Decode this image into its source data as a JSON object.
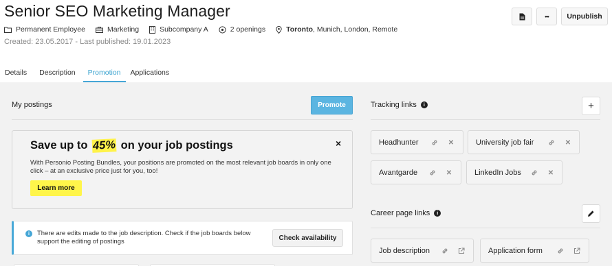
{
  "job": {
    "title": "Senior SEO Marketing Manager",
    "meta": {
      "employment": "Permanent Employee",
      "department": "Marketing",
      "company": "Subcompany A",
      "openings": "2 openings",
      "location_primary": "Toronto",
      "location_rest": ", Munich, London, Remote"
    },
    "dates": "Created: 23.05.2017 - Last published: 19.01.2023"
  },
  "header_actions": {
    "unpublish": "Unpublish",
    "more": "•••"
  },
  "tabs": [
    {
      "label": "Details",
      "active": false
    },
    {
      "label": "Description",
      "active": false
    },
    {
      "label": "Promotion",
      "active": true
    },
    {
      "label": "Applications",
      "active": false
    }
  ],
  "postings": {
    "title": "My postings",
    "promote": "Promote",
    "bundle": {
      "title_before": "Save up to",
      "title_number": "45%",
      "title_after": "on your job postings",
      "text": "With Personio Posting Bundles, your positions are promoted on the most relevant job boards in only one click – at an exclusive price just for you, too!",
      "button": "Learn more"
    },
    "notice": {
      "text": "There are edits made to the job description. Check if the job boards below support the editing of postings",
      "button": "Check availability"
    }
  },
  "tracking": {
    "title": "Tracking links",
    "add": "+",
    "links": [
      "Headhunter",
      "University job fair",
      "Avantgarde",
      "LinkedIn Jobs"
    ]
  },
  "career": {
    "title": "Career page links",
    "links": [
      "Job description",
      "Application form"
    ]
  },
  "colors": {
    "accent": "#45a6d6",
    "highlight": "#fff54a",
    "background": "#f2f2f2"
  }
}
